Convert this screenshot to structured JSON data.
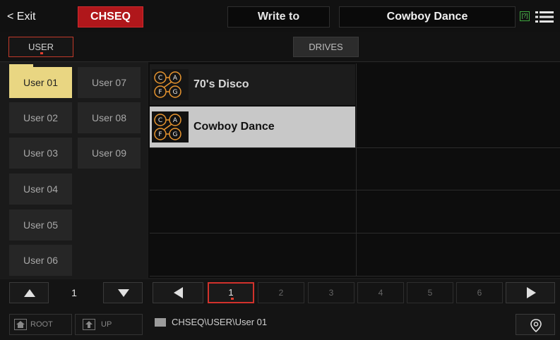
{
  "header": {
    "exit_label": "< Exit",
    "mode_label": "CHSEQ",
    "write_label": "Write to",
    "name_value": "Cowboy Dance",
    "help_icon": "[?]"
  },
  "tabs": {
    "user_label": "USER",
    "drives_label": "DRIVES"
  },
  "folders": {
    "col1": [
      "User 01",
      "User 02",
      "User 03",
      "User 04",
      "User 05",
      "User 06"
    ],
    "col2": [
      "User 07",
      "User 08",
      "User 09"
    ],
    "selected": "User 01"
  },
  "entries": [
    {
      "label": "70's Disco",
      "selected": false
    },
    {
      "label": "Cowboy Dance",
      "selected": true
    }
  ],
  "folder_pager": {
    "value": "1"
  },
  "pages": [
    "1",
    "2",
    "3",
    "4",
    "5",
    "6"
  ],
  "active_page": "1",
  "footer": {
    "root_label": "ROOT",
    "up_label": "UP",
    "path": "CHSEQ\\USER\\User 01"
  },
  "colors": {
    "accent_red": "#b0171b",
    "selected_folder": "#e9d682",
    "selected_entry": "#c8c8c8",
    "icon_orange": "#e8952f"
  }
}
